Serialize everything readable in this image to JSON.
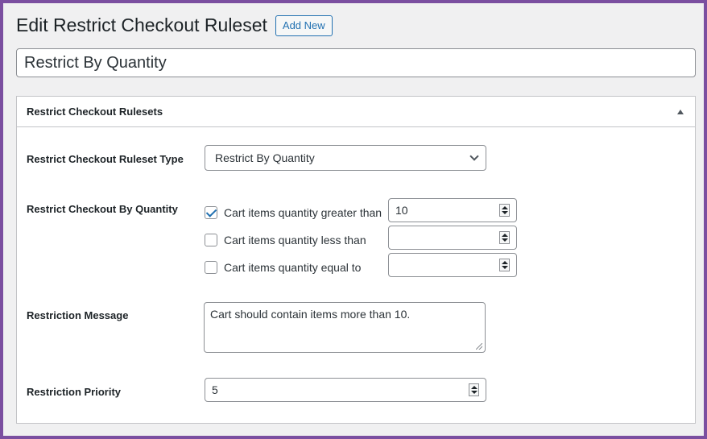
{
  "header": {
    "title": "Edit Restrict Checkout Ruleset",
    "add_new_label": "Add New"
  },
  "post_title": "Restrict By Quantity",
  "metabox": {
    "title": "Restrict Checkout Rulesets",
    "ruleset_type": {
      "label": "Restrict Checkout Ruleset Type",
      "selected": "Restrict By Quantity"
    },
    "by_quantity": {
      "label": "Restrict Checkout By Quantity",
      "options": [
        {
          "label": "Cart items quantity greater than",
          "checked": true,
          "value": "10"
        },
        {
          "label": "Cart items quantity less than",
          "checked": false,
          "value": ""
        },
        {
          "label": "Cart items quantity equal to",
          "checked": false,
          "value": ""
        }
      ]
    },
    "message": {
      "label": "Restriction Message",
      "value": "Cart should contain items more than 10."
    },
    "priority": {
      "label": "Restriction Priority",
      "value": "5"
    }
  }
}
